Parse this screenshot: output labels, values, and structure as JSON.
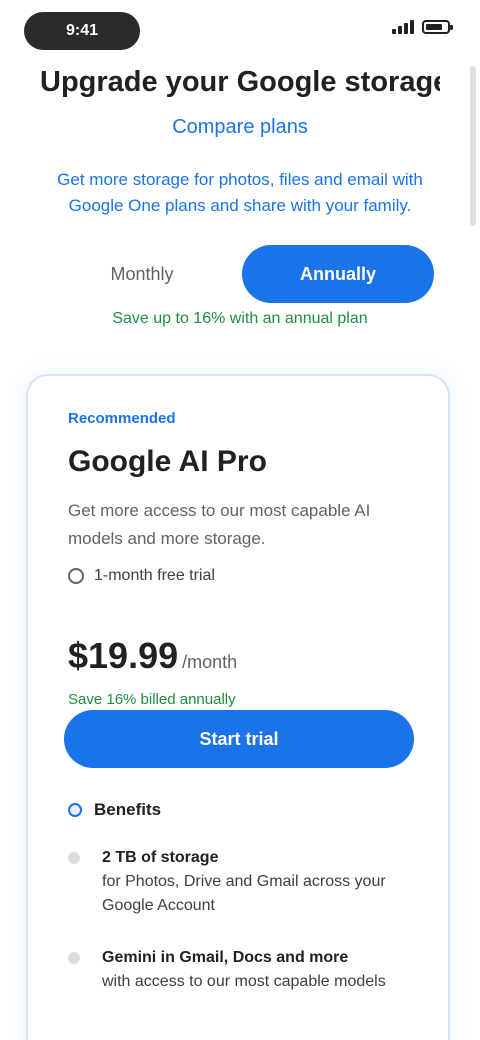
{
  "status_bar": {
    "time": "9:41"
  },
  "hero": {
    "title": "Upgrade your Google storage plan",
    "link": "Compare plans",
    "description": "Get more storage for photos, files and email with Google One plans and share with your family."
  },
  "billing": {
    "monthly_label": "Monthly",
    "annual_label": "Annually",
    "savings_note": "Save up to 16% with an annual plan"
  },
  "plan": {
    "badge": "Recommended",
    "name": "Google AI Pro",
    "description": "Get more access to our most capable AI models and more storage.",
    "trial": "1-month free trial",
    "price": "$19.99",
    "period": "/month",
    "price_note": "Save 16% billed annually",
    "cta_label": "Start trial",
    "features_heading": "Benefits",
    "features": [
      {
        "title": "2 TB of storage",
        "text": "for Photos, Drive and Gmail across your Google Account"
      },
      {
        "title": "Gemini in Gmail, Docs and more",
        "text": "with access to our most capable models"
      }
    ]
  },
  "colors": {
    "accent": "#1a73e8",
    "success": "#1e8e3e",
    "card_border": "#d2e3fc"
  }
}
